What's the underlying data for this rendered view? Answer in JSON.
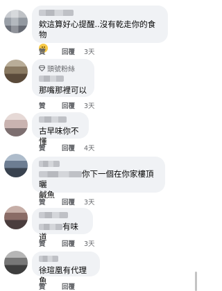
{
  "actions": {
    "like": "贊",
    "reply": "回覆"
  },
  "comments": [
    {
      "text": "欸這算好心提醒..沒有乾走你的食物",
      "emoji": "smiling-face",
      "time": "3天"
    },
    {
      "badge": "頭號粉絲",
      "text": "那嘴那裡可以",
      "time": "3天"
    },
    {
      "text": "古早味你不懂",
      "time": "4天"
    },
    {
      "text_line1": "你下一個在你家樓頂曬",
      "text_line2": "鹹魚",
      "time": "3天"
    },
    {
      "text": "有味道",
      "time": "3天"
    },
    {
      "text": "徐瑄凰有代理魚",
      "time": ""
    }
  ]
}
